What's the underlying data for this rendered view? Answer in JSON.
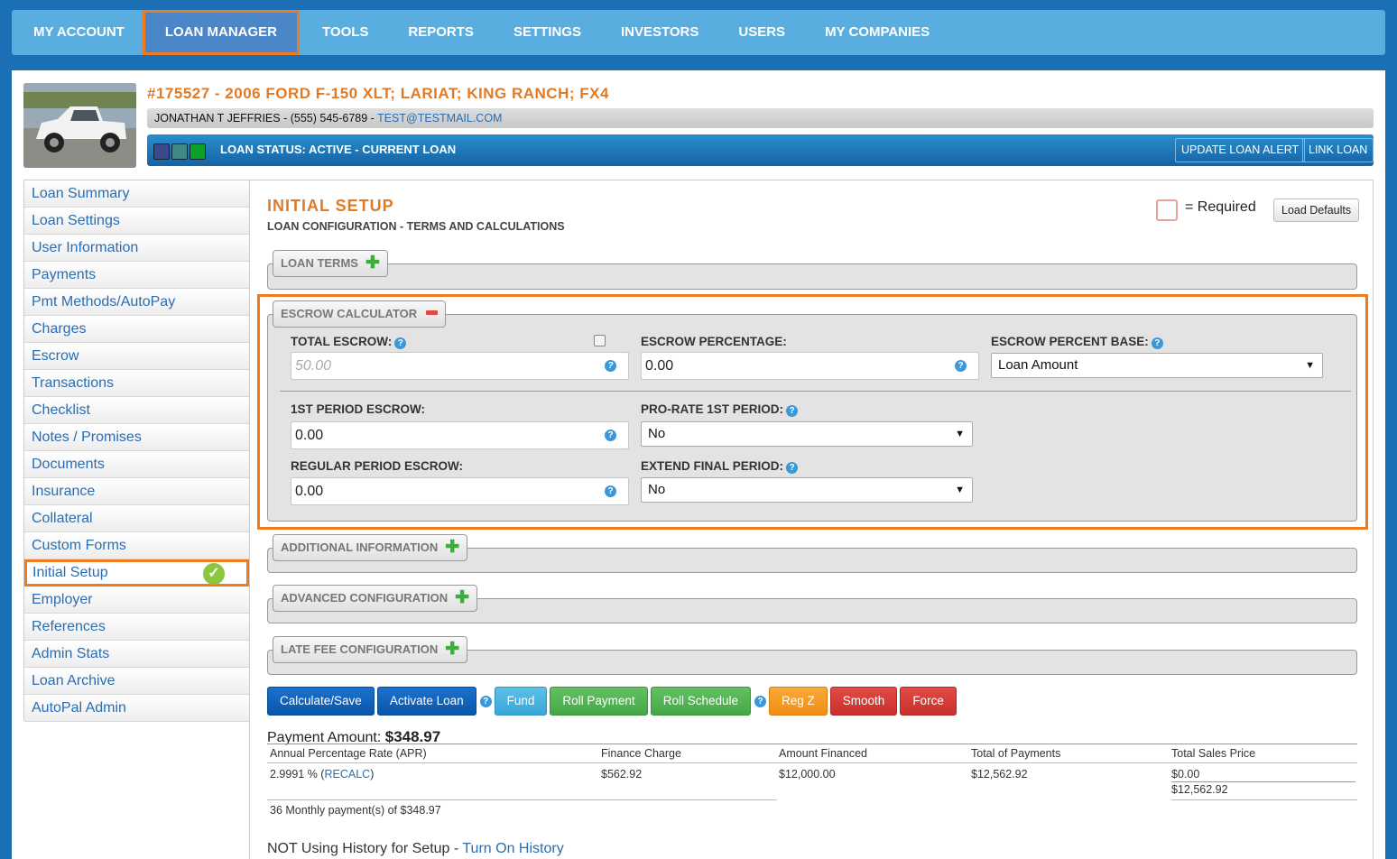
{
  "topnav": {
    "items": [
      "MY ACCOUNT",
      "LOAN MANAGER",
      "TOOLS",
      "REPORTS",
      "SETTINGS",
      "INVESTORS",
      "USERS",
      "MY COMPANIES"
    ]
  },
  "header": {
    "title": "#175527 - 2006 FORD F-150 XLT; LARIAT; KING RANCH; FX4",
    "contact_name": "JONATHAN T JEFFRIES - (555) 545-6789 - ",
    "contact_email": "TEST@TESTMAIL.COM",
    "loan_status": "LOAN STATUS: ACTIVE - CURRENT LOAN",
    "update_alert_label": "UPDATE LOAN ALERT",
    "link_loan_label": "LINK LOAN",
    "status_colors": [
      "#3b4a8c",
      "#3f8a86",
      "#0ea02a"
    ]
  },
  "sidebar": {
    "items": [
      "Loan Summary",
      "Loan Settings",
      "User Information",
      "Payments",
      "Pmt Methods/AutoPay",
      "Charges",
      "Escrow",
      "Transactions",
      "Checklist",
      "Notes / Promises",
      "Documents",
      "Insurance",
      "Collateral",
      "Custom Forms",
      "Initial Setup",
      "Employer",
      "References",
      "Admin Stats",
      "Loan Archive",
      "AutoPal Admin"
    ],
    "active": "Initial Setup"
  },
  "main": {
    "title": "INITIAL SETUP",
    "subtitle": "LOAN CONFIGURATION - TERMS AND CALCULATIONS",
    "required_text": "= Required",
    "load_defaults": "Load Defaults",
    "sections": {
      "loan_terms": "LOAN TERMS",
      "escrow": "ESCROW CALCULATOR",
      "additional": "ADDITIONAL INFORMATION",
      "advanced": "ADVANCED CONFIGURATION",
      "late_fee": "LATE FEE CONFIGURATION"
    },
    "escrow": {
      "total_escrow_label": "TOTAL ESCROW:",
      "total_escrow_placeholder": "50.00",
      "escrow_percentage_label": "ESCROW PERCENTAGE:",
      "escrow_percentage_value": "0.00",
      "percent_base_label": "ESCROW PERCENT BASE:",
      "percent_base_value": "Loan Amount",
      "first_period_label": "1ST PERIOD ESCROW:",
      "first_period_value": "0.00",
      "prorate_label": "PRO-RATE 1ST PERIOD:",
      "prorate_value": "No",
      "regular_period_label": "REGULAR PERIOD ESCROW:",
      "regular_period_value": "0.00",
      "extend_final_label": "EXTEND FINAL PERIOD:",
      "extend_final_value": "No"
    },
    "actions": [
      "Calculate/Save",
      "Activate Loan",
      "Fund",
      "Roll Payment",
      "Roll Schedule",
      "Reg Z",
      "Smooth",
      "Force"
    ],
    "payment": {
      "label": "Payment Amount: ",
      "amount": "$348.97"
    },
    "disclosure": {
      "headers": [
        "Annual Percentage Rate (APR)",
        "Finance Charge",
        "Amount Financed",
        "Total of Payments",
        "Total Sales Price"
      ],
      "apr": "2.9991 % (",
      "recalc": "RECALC",
      "apr_close": ")",
      "finance_charge": "$562.92",
      "amount_financed": "$12,000.00",
      "total_payments": "$12,562.92",
      "sales_price_1": "$0.00",
      "sales_price_2": "$12,562.92",
      "schedule": "36 Monthly payment(s) of $348.97"
    },
    "history": {
      "text": "NOT Using History for Setup - ",
      "link": "Turn On History"
    }
  }
}
